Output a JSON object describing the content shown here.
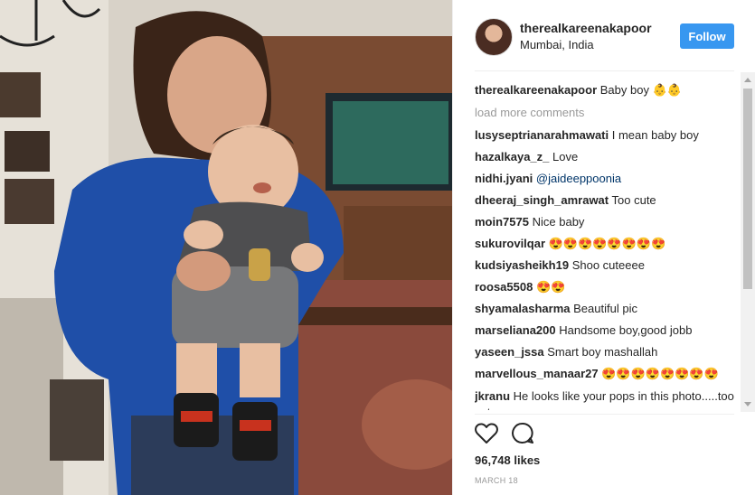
{
  "post": {
    "username": "therealkareenakapoor",
    "location": "Mumbai, India",
    "follow_label": "Follow",
    "likes": "96,748 likes",
    "date": "MARCH 18"
  },
  "caption": {
    "user": "therealkareenakapoor",
    "text": "Baby boy 👶👶"
  },
  "load_more": "load more comments",
  "comments": [
    {
      "user": "lusyseptrianarahmawati",
      "text": "I mean baby boy"
    },
    {
      "user": "hazalkaya_z_",
      "text": "Love"
    },
    {
      "user": "nidhi.jyani",
      "text": "@jaideeppoonia"
    },
    {
      "user": "dheeraj_singh_amrawat",
      "text": "Too cute"
    },
    {
      "user": "moin7575",
      "text": "Nice baby"
    },
    {
      "user": "sukurovilqar",
      "text": "😍😍😍😍😍😍😍😍"
    },
    {
      "user": "kudsiyasheikh19",
      "text": "Shoo cuteeee"
    },
    {
      "user": "roosa5508",
      "text": "😍😍"
    },
    {
      "user": "shyamalasharma",
      "text": "Beautiful pic"
    },
    {
      "user": "marseliana200",
      "text": "Handsome boy,good jobb"
    },
    {
      "user": "yaseen_jssa",
      "text": "Smart boy mashallah"
    },
    {
      "user": "marvellous_manaar27",
      "text": "😍😍😍😍😍😍😍😍"
    },
    {
      "user": "jkranu",
      "text": "He looks like your pops in this photo.....too cute yu"
    }
  ],
  "icons": {
    "like": "heart-icon",
    "comment": "comment-icon"
  },
  "colors": {
    "follow": "#3897f0",
    "mention": "#003569",
    "muted": "#999999"
  }
}
